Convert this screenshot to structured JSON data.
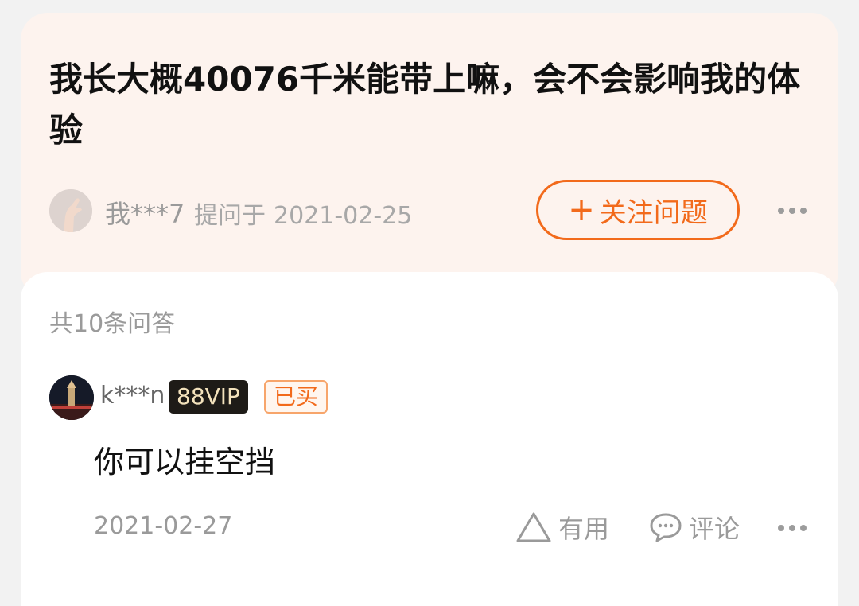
{
  "question": {
    "title": "我长大概40076千米能带上嘛，会不会影响我的体验",
    "asker_name": "我***7",
    "asked_label": "提问于",
    "asked_date": "2021-02-25",
    "follow_label": "关注问题",
    "follow_icon": "plus-icon"
  },
  "answers": {
    "count_label": "共10条问答",
    "items": [
      {
        "user_name": "k***n",
        "vip_badge": "88VIP",
        "bought_badge": "已买",
        "text": "你可以挂空挡",
        "date": "2021-02-27",
        "useful_label": "有用",
        "comment_label": "评论"
      }
    ]
  },
  "colors": {
    "accent": "#f26a1b",
    "question_bg": "#fdf3ee",
    "vip_bg": "#1e1b17",
    "vip_text": "#f3e2bc"
  }
}
